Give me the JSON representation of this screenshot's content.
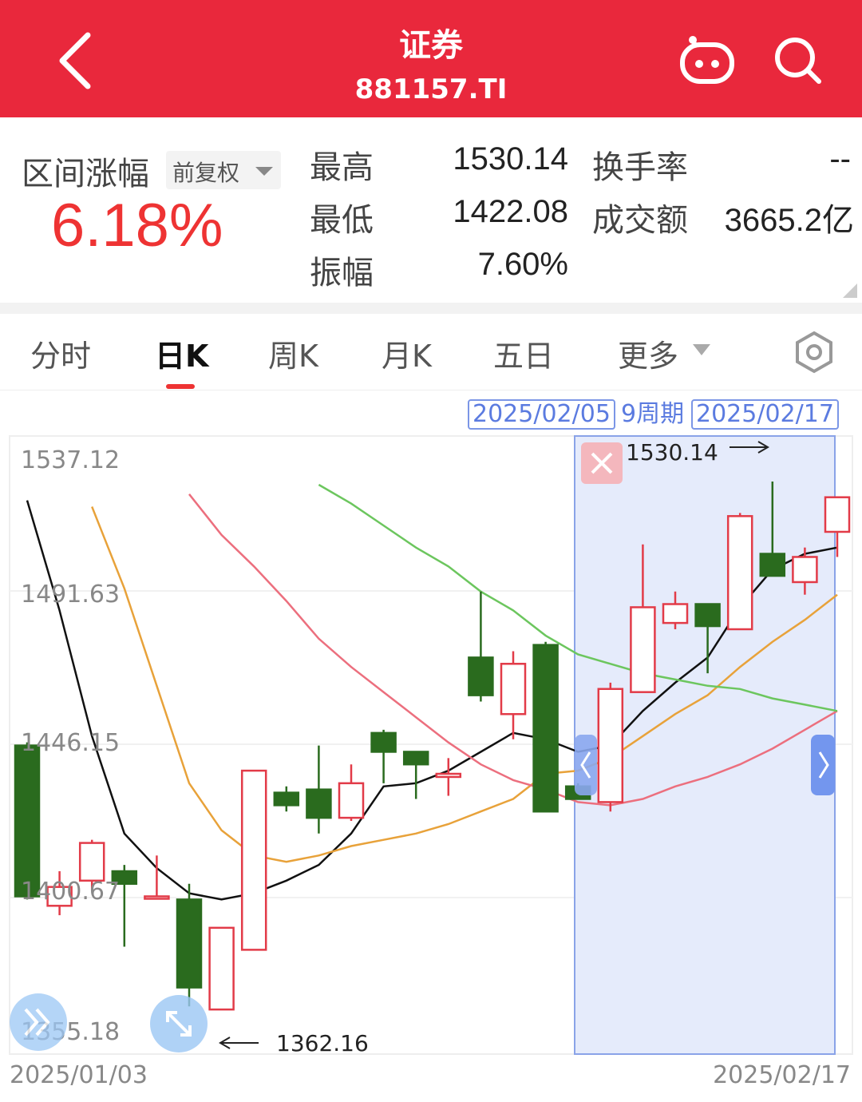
{
  "header": {
    "title": "证券",
    "code": "881157.TI",
    "bg_color": "#e9283c"
  },
  "summary": {
    "range_change_label": "区间涨幅",
    "adjust_label": "前复权",
    "range_change_value": "6.18%",
    "high_label": "最高",
    "high_value": "1530.14",
    "low_label": "最低",
    "low_value": "1422.08",
    "amplitude_label": "振幅",
    "amplitude_value": "7.60%",
    "turnover_label": "换手率",
    "turnover_value": "--",
    "volume_label": "成交额",
    "volume_value": "3665.2亿"
  },
  "tabs": [
    {
      "label": "分时"
    },
    {
      "label": "日K"
    },
    {
      "label": "周K"
    },
    {
      "label": "月K"
    },
    {
      "label": "五日"
    },
    {
      "label": "更多"
    }
  ],
  "range": {
    "start": "2025/02/05",
    "periods": "9周期",
    "end": "2025/02/17"
  },
  "chart_data": {
    "type": "candlestick",
    "y_ticks": [
      "1537.12",
      "1491.63",
      "1446.15",
      "1400.67",
      "1355.18"
    ],
    "ylim": [
      1355.18,
      1537.12
    ],
    "x_start_label": "2025/01/03",
    "x_end_label": "2025/02/17",
    "max_label": "1530.14",
    "min_label": "1362.16",
    "up_color": "#e23b48",
    "down_color": "#2a6b1e",
    "selection_start_index": 18,
    "candles": [
      {
        "o": 1446,
        "h": 1447,
        "l": 1397,
        "c": 1398
      },
      {
        "o": 1395,
        "h": 1406,
        "l": 1392,
        "c": 1401
      },
      {
        "o": 1403,
        "h": 1416,
        "l": 1400,
        "c": 1415
      },
      {
        "o": 1406,
        "h": 1408,
        "l": 1382,
        "c": 1402
      },
      {
        "o": 1398,
        "h": 1411,
        "l": 1397,
        "c": 1398
      },
      {
        "o": 1397,
        "h": 1402,
        "l": 1363,
        "c": 1369
      },
      {
        "o": 1362,
        "h": 1366,
        "l": 1362,
        "c": 1388
      },
      {
        "o": 1381,
        "h": 1431,
        "l": 1381,
        "c": 1438
      },
      {
        "o": 1431,
        "h": 1433,
        "l": 1425,
        "c": 1427
      },
      {
        "o": 1432,
        "h": 1446,
        "l": 1418,
        "c": 1423
      },
      {
        "o": 1423,
        "h": 1440,
        "l": 1422,
        "c": 1434
      },
      {
        "o": 1450,
        "h": 1451,
        "l": 1434,
        "c": 1444
      },
      {
        "o": 1444,
        "h": 1444,
        "l": 1429,
        "c": 1440
      },
      {
        "o": 1436,
        "h": 1442,
        "l": 1430,
        "c": 1437
      },
      {
        "o": 1474,
        "h": 1495,
        "l": 1460,
        "c": 1462
      },
      {
        "o": 1456,
        "h": 1476,
        "l": 1448,
        "c": 1472
      },
      {
        "o": 1478,
        "h": 1479,
        "l": 1425,
        "c": 1425
      },
      {
        "o": 1433,
        "h": 1434,
        "l": 1429,
        "c": 1429
      },
      {
        "o": 1428,
        "h": 1466,
        "l": 1425,
        "c": 1464
      },
      {
        "o": 1463,
        "h": 1510,
        "l": 1463,
        "c": 1490
      },
      {
        "o": 1485,
        "h": 1495,
        "l": 1483,
        "c": 1491
      },
      {
        "o": 1491,
        "h": 1491,
        "l": 1469,
        "c": 1484
      },
      {
        "o": 1483,
        "h": 1520,
        "l": 1483,
        "c": 1519
      },
      {
        "o": 1507,
        "h": 1530,
        "l": 1501,
        "c": 1500
      },
      {
        "o": 1498,
        "h": 1509,
        "l": 1494,
        "c": 1506
      },
      {
        "o": 1514,
        "h": 1516,
        "l": 1506,
        "c": 1525
      }
    ],
    "ma_lines": [
      {
        "color": "#111111",
        "values": [
          1524,
          1489,
          1449,
          1418,
          1407,
          1399,
          1397,
          1399,
          1403,
          1408,
          1418,
          1433,
          1434,
          1438,
          1444,
          1450,
          1448,
          1444,
          1446,
          1457,
          1466,
          1474,
          1490,
          1502,
          1507,
          1509
        ]
      },
      {
        "color": "#e8a23a",
        "values": [
          null,
          null,
          1522,
          1496,
          1465,
          1434,
          1419,
          1411,
          1409,
          1411,
          1414,
          1416,
          1418,
          1421,
          1425,
          1429,
          1437,
          1438,
          1442,
          1449,
          1456,
          1462,
          1471,
          1479,
          1486,
          1494
        ]
      },
      {
        "color": "#ec6f7e",
        "values": [
          null,
          null,
          null,
          null,
          null,
          1526,
          1513,
          1503,
          1492,
          1480,
          1471,
          1463,
          1455,
          1447,
          1440,
          1435,
          1432,
          1428,
          1427,
          1429,
          1433,
          1436,
          1440,
          1445,
          1451,
          1457
        ]
      },
      {
        "color": "#6cc65e",
        "values": [
          null,
          null,
          null,
          null,
          null,
          null,
          null,
          null,
          null,
          1529,
          1523,
          1516,
          1509,
          1503,
          1495,
          1489,
          1481,
          1475,
          1472,
          1469,
          1467,
          1465,
          1464,
          1461,
          1459,
          1457
        ]
      }
    ]
  }
}
